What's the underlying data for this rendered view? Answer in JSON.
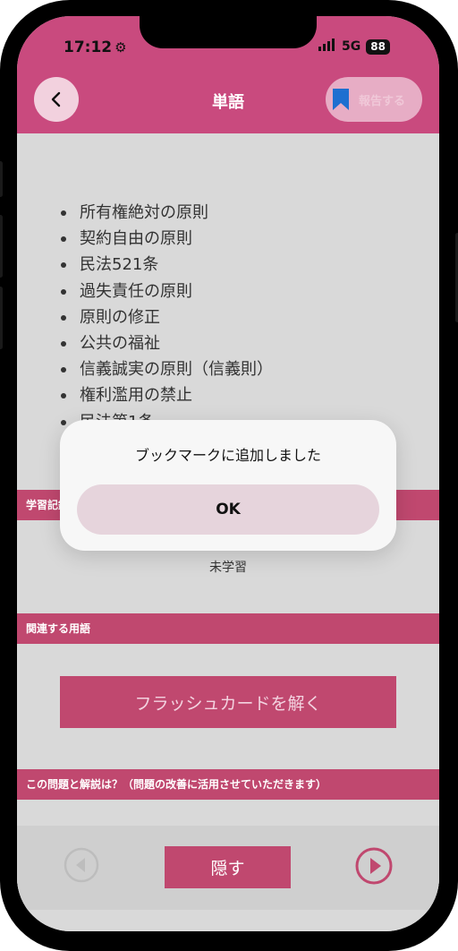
{
  "status_bar": {
    "time": "17:12",
    "network": "5G",
    "battery": "88"
  },
  "header": {
    "title": "単語",
    "report_label": "報告する"
  },
  "terms": [
    "所有権絶対の原則",
    "契約自由の原則",
    "民法521条",
    "過失責任の原則",
    "原則の修正",
    "公共の福祉",
    "信義誠実の原則（信義則）",
    "権利濫用の禁止",
    "民法第1条"
  ],
  "sections": {
    "study_record": "学習記録",
    "related_terms": "関連する用語",
    "feedback": "この問題と解説は？（問題の改善に活用させていただきます）"
  },
  "study_status": "未学習",
  "flashcard_button": "フラッシュカードを解く",
  "hide_button": "隠す",
  "dialog": {
    "message": "ブックマークに追加しました",
    "ok_label": "OK"
  },
  "colors": {
    "accent": "#c94a7e",
    "section": "#c0486f",
    "bookmark": "#1e6fd0"
  }
}
